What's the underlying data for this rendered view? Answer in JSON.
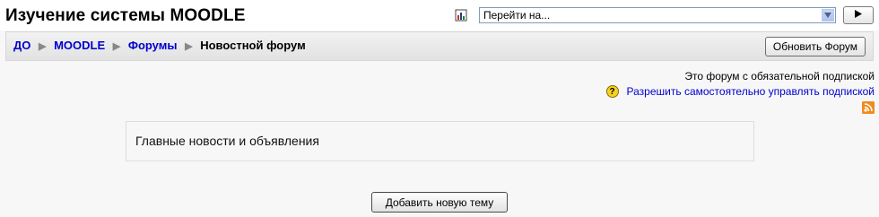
{
  "header": {
    "site_title": "Изучение системы MOODLE",
    "jump_select": {
      "selected": "Перейти на..."
    }
  },
  "breadcrumb": {
    "items": [
      "ДО",
      "MOODLE",
      "Форумы"
    ],
    "current": "Новостной форум"
  },
  "navbar": {
    "update_button": "Обновить Форум"
  },
  "subscription": {
    "info": "Это форум с обязательной подпиской",
    "allow_link": "Разрешить самостоятельно управлять подпиской"
  },
  "intro": {
    "text": "Главные новости и объявления"
  },
  "actions": {
    "add_topic": "Добавить новую тему"
  },
  "icons": {
    "report": "report-icon",
    "dropdown": "chevron-down-icon",
    "go": "play-arrow-icon",
    "separator": "triangle-right-icon",
    "help": "help-icon",
    "rss": "rss-icon"
  },
  "colors": {
    "link": "#0000cc",
    "navbar_bg": "#e9e9e9",
    "help_yellow": "#f7d21f",
    "rss_orange": "#f28b1d"
  }
}
